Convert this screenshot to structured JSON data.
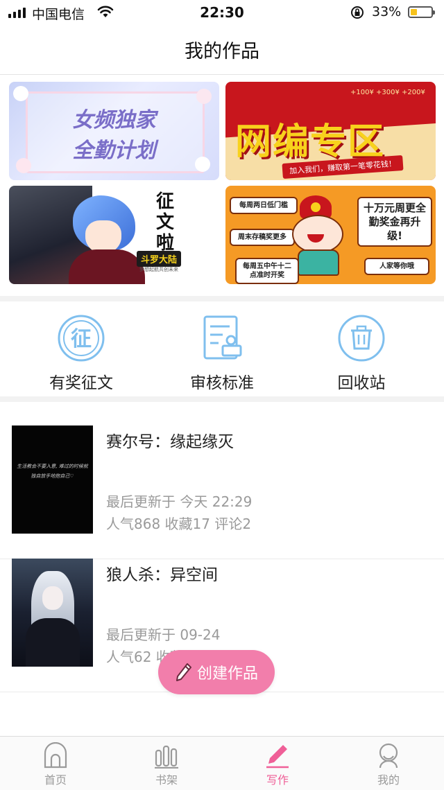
{
  "status_bar": {
    "carrier": "中国电信",
    "time": "22:30",
    "battery_percent": "33%",
    "battery_level": 0.33,
    "icons": [
      "signal-icon",
      "wifi-icon",
      "rotation-lock-icon",
      "battery-icon"
    ]
  },
  "nav": {
    "title": "我的作品"
  },
  "banners": [
    {
      "name": "banner-female-exclusive",
      "line1": "女频独家",
      "line2": "全勤计划"
    },
    {
      "name": "banner-web-series",
      "title": "网编专区",
      "coins": "+100¥  +300¥  +200¥",
      "subtitle": "加入我们，赚取第一笔零花钱！"
    },
    {
      "name": "banner-contest",
      "vertical_text": "征文啦",
      "tag": "斗罗大陆",
      "small_text": "梦想起航共创未来"
    },
    {
      "name": "banner-weekly-reward",
      "bubbles": [
        "每周两日低门槛",
        "周末存稿奖更多",
        "每周五中午十二点准时开奖",
        "人家等你哦"
      ],
      "headline": "十万元周更全勤奖金再升级!"
    }
  ],
  "actions": [
    {
      "label": "有奖征文",
      "icon": "contest-badge-icon"
    },
    {
      "label": "审核标准",
      "icon": "review-document-icon"
    },
    {
      "label": "回收站",
      "icon": "trash-icon"
    }
  ],
  "works": [
    {
      "title": "赛尔号：缘起缘灭",
      "updated": "最后更新于 今天 22:29",
      "stats": "人气868 收藏17 评论2",
      "cover_text": "生活教会不要入意, 难过的时候就独自放手地抱自己♡"
    },
    {
      "title": "狼人杀：异空间",
      "updated": "最后更新于 09-24",
      "stats": "人气62 收藏2 评论2"
    }
  ],
  "create_button": {
    "label": "创建作品",
    "icon": "pencil-icon"
  },
  "tabbar": {
    "items": [
      {
        "label": "首页",
        "icon": "home-icon"
      },
      {
        "label": "书架",
        "icon": "bookshelf-icon"
      },
      {
        "label": "写作",
        "icon": "write-pencil-icon"
      },
      {
        "label": "我的",
        "icon": "profile-icon"
      }
    ],
    "active": "写作",
    "active_color": "#ef5f97",
    "inactive_color": "#9a9a9a"
  },
  "colors": {
    "accent_pink": "#f27eab",
    "icon_blue": "#7fbfee"
  }
}
